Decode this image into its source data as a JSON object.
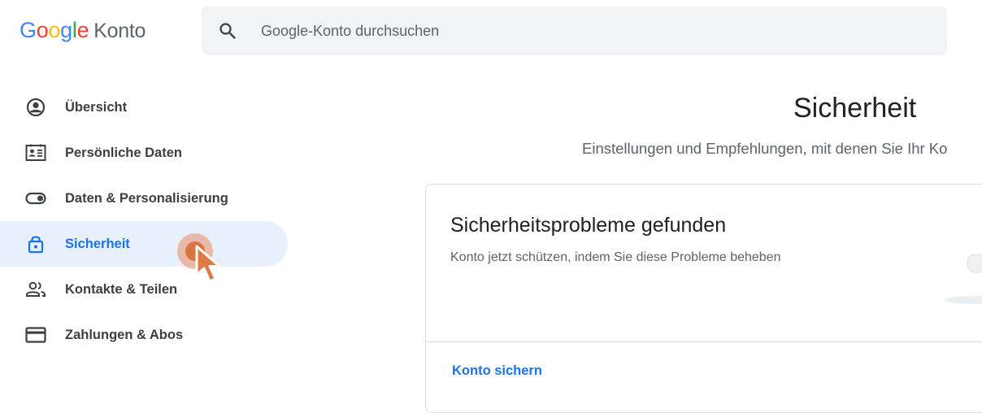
{
  "header": {
    "logo_google": [
      "G",
      "o",
      "o",
      "g",
      "l",
      "e"
    ],
    "product": "Konto",
    "search_placeholder": "Google-Konto durchsuchen"
  },
  "sidebar": {
    "items": [
      {
        "label": "Übersicht",
        "icon": "account-circle-icon",
        "active": false
      },
      {
        "label": "Persönliche Daten",
        "icon": "id-card-icon",
        "active": false
      },
      {
        "label": "Daten & Personalisierung",
        "icon": "toggle-icon",
        "active": false
      },
      {
        "label": "Sicherheit",
        "icon": "lock-icon",
        "active": true
      },
      {
        "label": "Kontakte & Teilen",
        "icon": "people-icon",
        "active": false
      },
      {
        "label": "Zahlungen & Abos",
        "icon": "credit-card-icon",
        "active": false
      }
    ]
  },
  "main": {
    "title": "Sicherheit",
    "subtitle": "Einstellungen und Empfehlungen, mit denen Sie Ihr Ko",
    "card": {
      "title": "Sicherheitsprobleme gefunden",
      "description": "Konto jetzt schützen, indem Sie diese Probleme beheben",
      "link": "Konto sichern"
    }
  },
  "colors": {
    "accent": "#1a73e8",
    "active_bg": "#e8f0fe",
    "cursor": "#e07a45"
  }
}
